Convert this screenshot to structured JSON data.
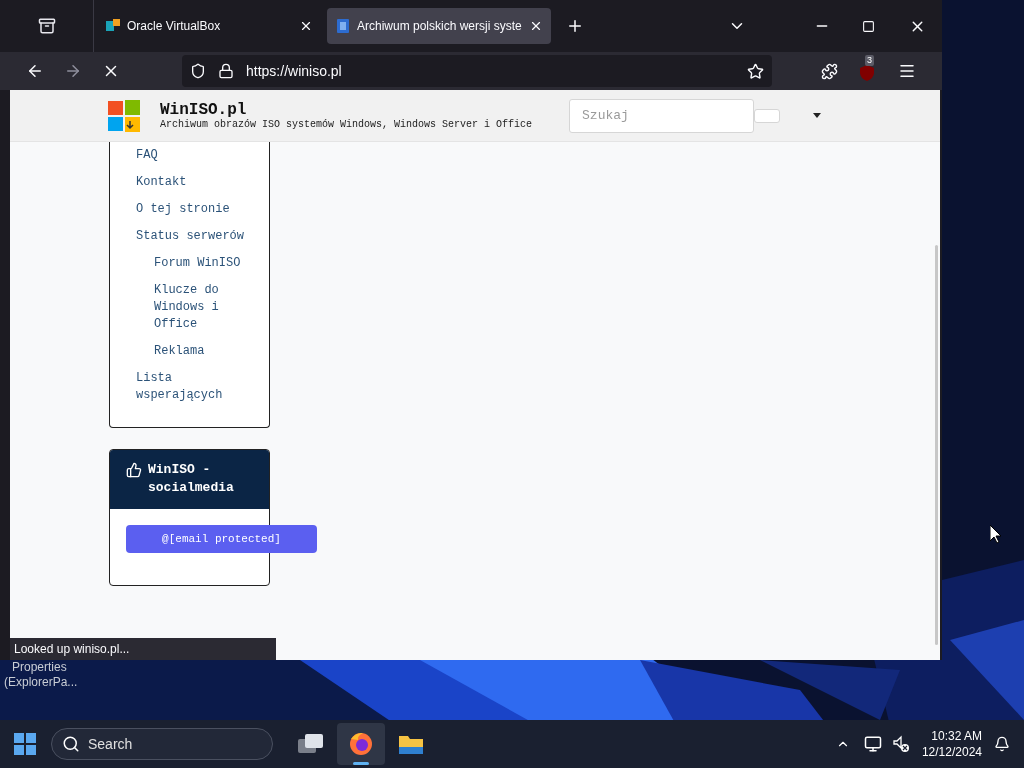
{
  "browser": {
    "tabs": [
      {
        "title": "Oracle VirtualBox",
        "selected": false
      },
      {
        "title": "Archiwum polskich wersji syste",
        "selected": true
      }
    ],
    "url": "https://winiso.pl",
    "extension_badge": "3",
    "status": "Looked up winiso.pl..."
  },
  "site": {
    "title": "WinISO.pl",
    "subtitle": "Archiwum obrazów ISO systemów Windows, Windows Server i Office",
    "search_placeholder": "Szukaj",
    "menu": [
      {
        "label": "FAQ"
      },
      {
        "label": "Kontakt"
      },
      {
        "label": "O tej stronie"
      },
      {
        "label": "Status serwerów",
        "children": [
          {
            "label": "Forum WinISO"
          },
          {
            "label": "Klucze do Windows i Office"
          },
          {
            "label": "Reklama"
          }
        ]
      },
      {
        "label": "Lista wsperających"
      }
    ],
    "social": {
      "title": "WinISO - socialmedia",
      "button": "@[email protected]"
    }
  },
  "desktop": {
    "icon_label_lines": [
      "Properties",
      "(ExplorerPa..."
    ]
  },
  "taskbar": {
    "search": "Search",
    "time": "10:32 AM",
    "date": "12/12/2024",
    "apps": [
      {
        "kind": "task-view",
        "selected": false
      },
      {
        "kind": "firefox",
        "selected": true
      },
      {
        "kind": "explorer",
        "selected": false
      }
    ]
  }
}
